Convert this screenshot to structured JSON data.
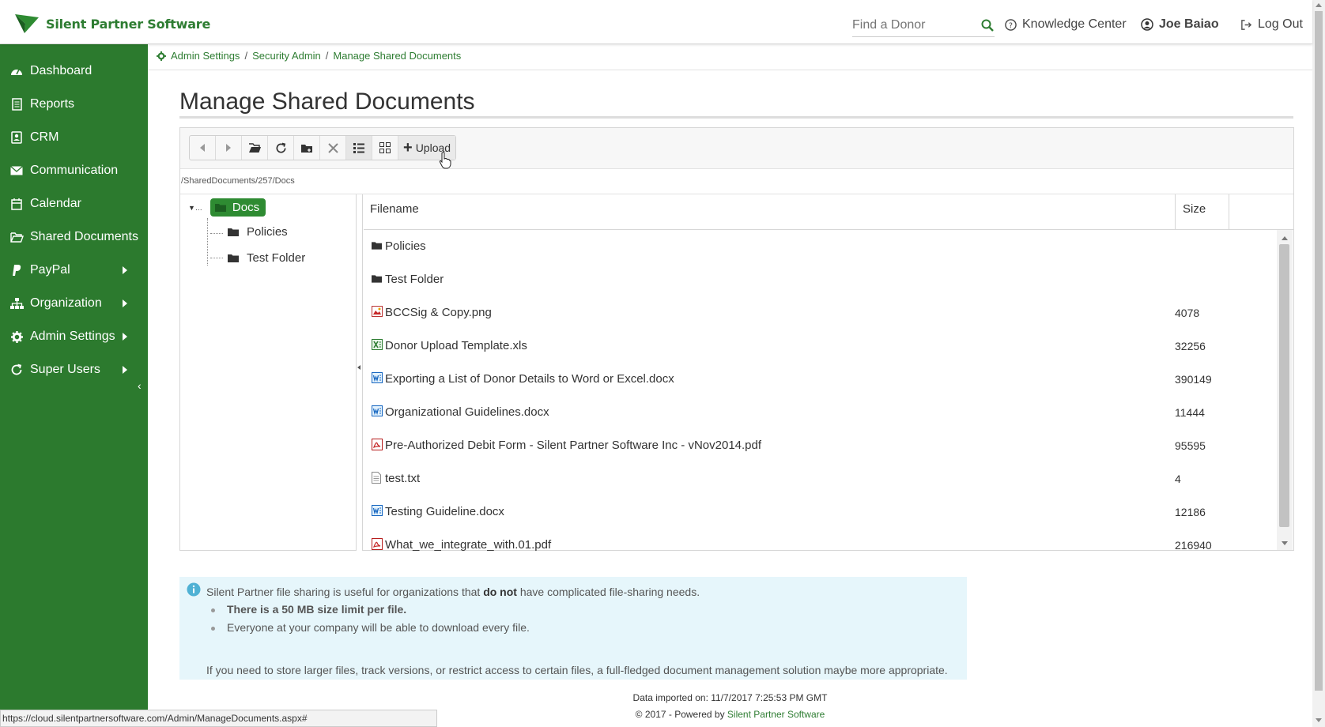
{
  "header": {
    "logo_text": "Silent Partner Software",
    "search_placeholder": "Find a Donor",
    "knowledge_center": "Knowledge Center",
    "user_name": "Joe Baiao",
    "logout": "Log Out"
  },
  "sidebar": {
    "items": [
      {
        "label": "Dashboard",
        "icon": "dashboard-icon",
        "has_submenu": false
      },
      {
        "label": "Reports",
        "icon": "report-icon",
        "has_submenu": false
      },
      {
        "label": "CRM",
        "icon": "contact-card-icon",
        "has_submenu": false
      },
      {
        "label": "Communication",
        "icon": "envelope-icon",
        "has_submenu": false
      },
      {
        "label": "Calendar",
        "icon": "calendar-icon",
        "has_submenu": false
      },
      {
        "label": "Shared Documents",
        "icon": "folder-open-icon",
        "has_submenu": false
      },
      {
        "label": "PayPal",
        "icon": "paypal-icon",
        "has_submenu": true
      },
      {
        "label": "Organization",
        "icon": "sitemap-icon",
        "has_submenu": true
      },
      {
        "label": "Admin Settings",
        "icon": "gear-icon",
        "has_submenu": true
      },
      {
        "label": "Super Users",
        "icon": "refresh-icon",
        "has_submenu": true
      }
    ]
  },
  "breadcrumb": {
    "items": [
      "Admin Settings",
      "Security Admin",
      "Manage Shared Documents"
    ]
  },
  "page": {
    "title": "Manage Shared Documents"
  },
  "file_manager": {
    "toolbar": {
      "upload_label": "Upload"
    },
    "path": "/SharedDocuments/257/Docs",
    "tree": {
      "root": "Docs",
      "children": [
        "Policies",
        "Test Folder"
      ]
    },
    "columns": {
      "filename": "Filename",
      "size": "Size"
    },
    "rows": [
      {
        "name": "Policies",
        "size": "",
        "type": "folder"
      },
      {
        "name": "Test Folder",
        "size": "",
        "type": "folder"
      },
      {
        "name": "BCCSig & Copy.png",
        "size": "4078",
        "type": "image"
      },
      {
        "name": "Donor Upload Template.xls",
        "size": "32256",
        "type": "excel"
      },
      {
        "name": "Exporting a List of Donor Details to Word or Excel.docx",
        "size": "390149",
        "type": "word"
      },
      {
        "name": "Organizational Guidelines.docx",
        "size": "11444",
        "type": "word"
      },
      {
        "name": "Pre-Authorized Debit Form - Silent Partner Software Inc - vNov2014.pdf",
        "size": "95595",
        "type": "pdf"
      },
      {
        "name": "test.txt",
        "size": "4",
        "type": "text"
      },
      {
        "name": "Testing Guideline.docx",
        "size": "12186",
        "type": "word"
      },
      {
        "name": "What_we_integrate_with.01.pdf",
        "size": "216940",
        "type": "pdf"
      }
    ]
  },
  "info": {
    "line1_pre": "Silent Partner file sharing is useful for organizations that ",
    "line1_bold": "do not",
    "line1_post": " have complicated file-sharing needs.",
    "bullet1": "There is a 50 MB size limit per file.",
    "bullet2": "Everyone at your company will be able to download every file.",
    "line3": "If you need to store larger files, track versions, or restrict access to certain files, a full-fledged document management solution maybe more appropriate."
  },
  "footer": {
    "imported": "Data imported on: 11/7/2017 7:25:53 PM GMT",
    "copyright": "© 2017 - Powered by ",
    "brand": "Silent Partner Software"
  },
  "status_bar": {
    "url": "https://cloud.silentpartnersoftware.com/Admin/ManageDocuments.aspx#"
  },
  "colors": {
    "sidebar": "#2c7a2e",
    "accent": "#2e7d32",
    "info_bg": "#e6f6fb"
  }
}
